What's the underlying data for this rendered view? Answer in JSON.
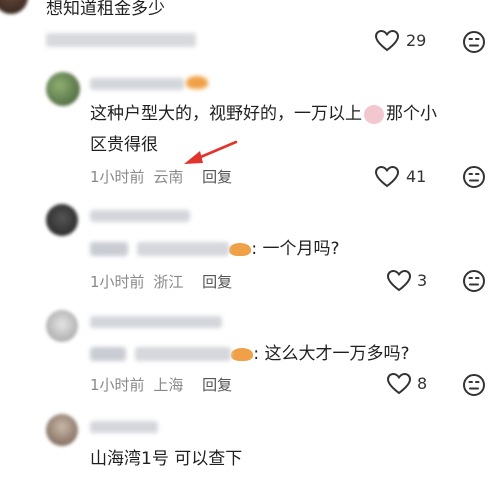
{
  "comments": [
    {
      "text": "想知道租金多少",
      "likes": "29"
    },
    {
      "text_line1": "这种户型大的，视野好的，一万以上",
      "text_after_emoji": "那个小",
      "text_line2": "区贵得很",
      "time": "1小时前",
      "location": "云南",
      "reply": "回复",
      "likes": "41"
    },
    {
      "text": ": 一个月吗?",
      "time": "1小时前",
      "location": "浙江",
      "reply": "回复",
      "likes": "3"
    },
    {
      "text": ": 这么大才一万多吗?",
      "time": "1小时前",
      "location": "上海",
      "reply": "回复",
      "likes": "8"
    },
    {
      "text": "山海湾1号 可以查下"
    }
  ],
  "colors": {
    "arrow": "#e0342c",
    "accent_emoji": "#f0a046"
  }
}
